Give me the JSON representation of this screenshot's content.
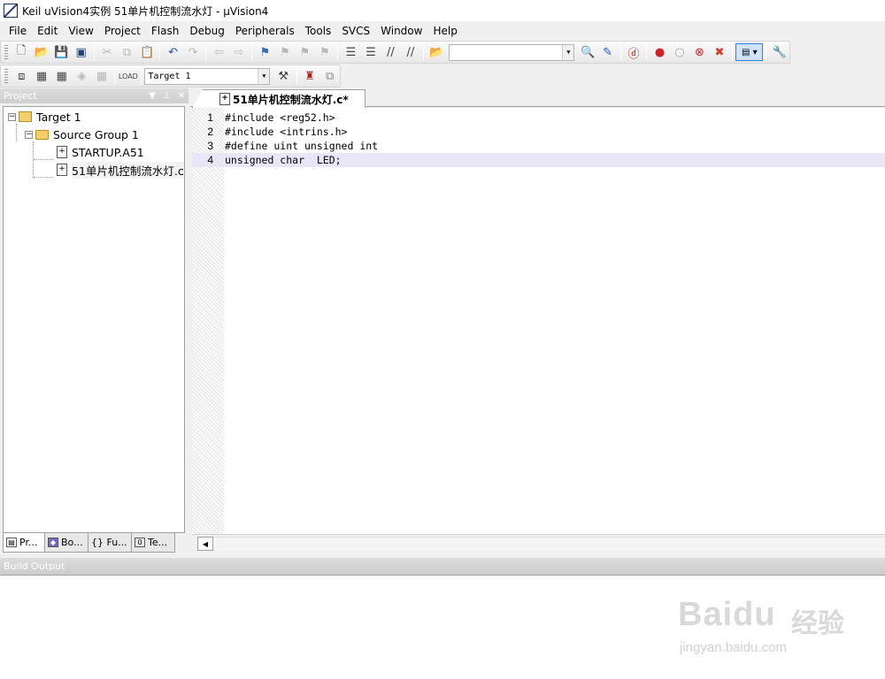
{
  "window": {
    "title": "Keil uVision4实例 51单片机控制流水灯  - µVision4"
  },
  "menu": [
    "File",
    "Edit",
    "View",
    "Project",
    "Flash",
    "Debug",
    "Peripherals",
    "Tools",
    "SVCS",
    "Window",
    "Help"
  ],
  "toolbar": {
    "target_combo": "Target 1",
    "find_combo": ""
  },
  "project_panel": {
    "title": "Project",
    "tree": {
      "target": "Target 1",
      "group": "Source Group 1",
      "files": [
        "STARTUP.A51",
        "51单片机控制流水灯.c"
      ]
    },
    "tabs": [
      "Pr...",
      "Bo...",
      "{} Fu...",
      "Te..."
    ]
  },
  "editor": {
    "tab_label": "51单片机控制流水灯.c*",
    "lines": [
      {
        "num": "1",
        "text": "#include <reg52.h>"
      },
      {
        "num": "2",
        "text": "#include <intrins.h>"
      },
      {
        "num": "3",
        "text": "#define uint unsigned int"
      },
      {
        "num": "4",
        "text": "unsigned char  LED;"
      }
    ],
    "current_line": 4
  },
  "build_output": {
    "title": "Build Output"
  },
  "watermark": {
    "logo": "Baidu",
    "cn": "经验",
    "url": "jingyan.baidu.com"
  }
}
